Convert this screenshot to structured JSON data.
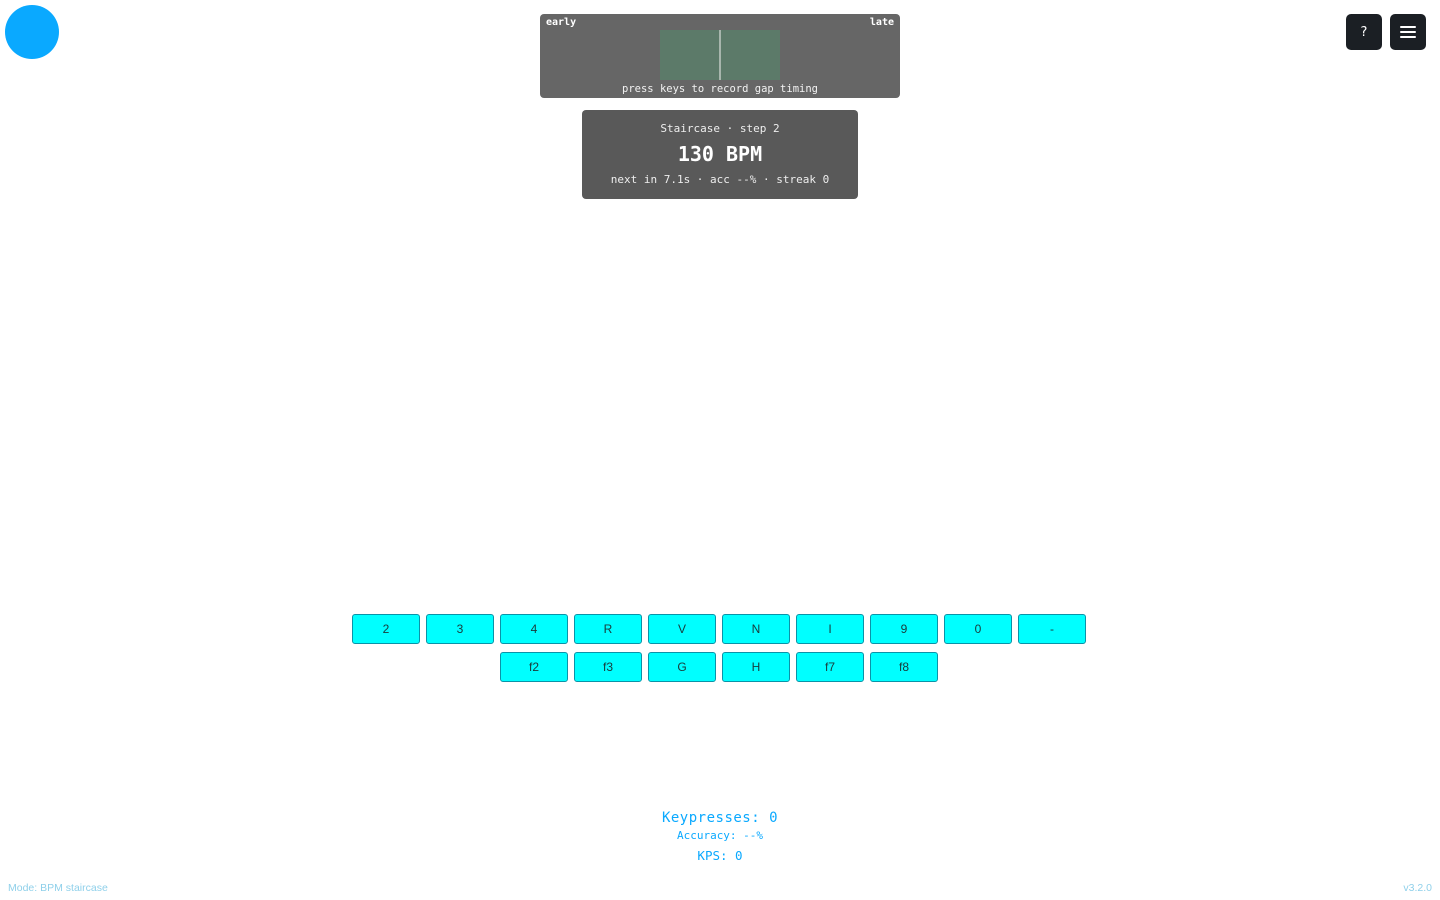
{
  "header": {
    "help_label": "?",
    "menu_icon": "hamburger-icon",
    "status_dot_color": "#0aa9ff"
  },
  "timing_panel": {
    "early_label": "early",
    "late_label": "late",
    "hint": "press keys to record gap timing"
  },
  "staircase": {
    "title": "Staircase · step 2",
    "bpm": "130 BPM",
    "subtitle": "next in 7.1s · acc --% · streak 0"
  },
  "keyboard": {
    "row1": [
      "2",
      "3",
      "4",
      "R",
      "V",
      "N",
      "I",
      "9",
      "0",
      "-"
    ],
    "row2": [
      "f2",
      "f3",
      "G",
      "H",
      "f7",
      "f8"
    ],
    "key_color": "#00ffff"
  },
  "stats": {
    "keypresses": "Keypresses: 0",
    "accuracy": "Accuracy: --%",
    "kps": "KPS: 0"
  },
  "footer": {
    "mode": "Mode: BPM staircase",
    "version": "v3.2.0"
  }
}
